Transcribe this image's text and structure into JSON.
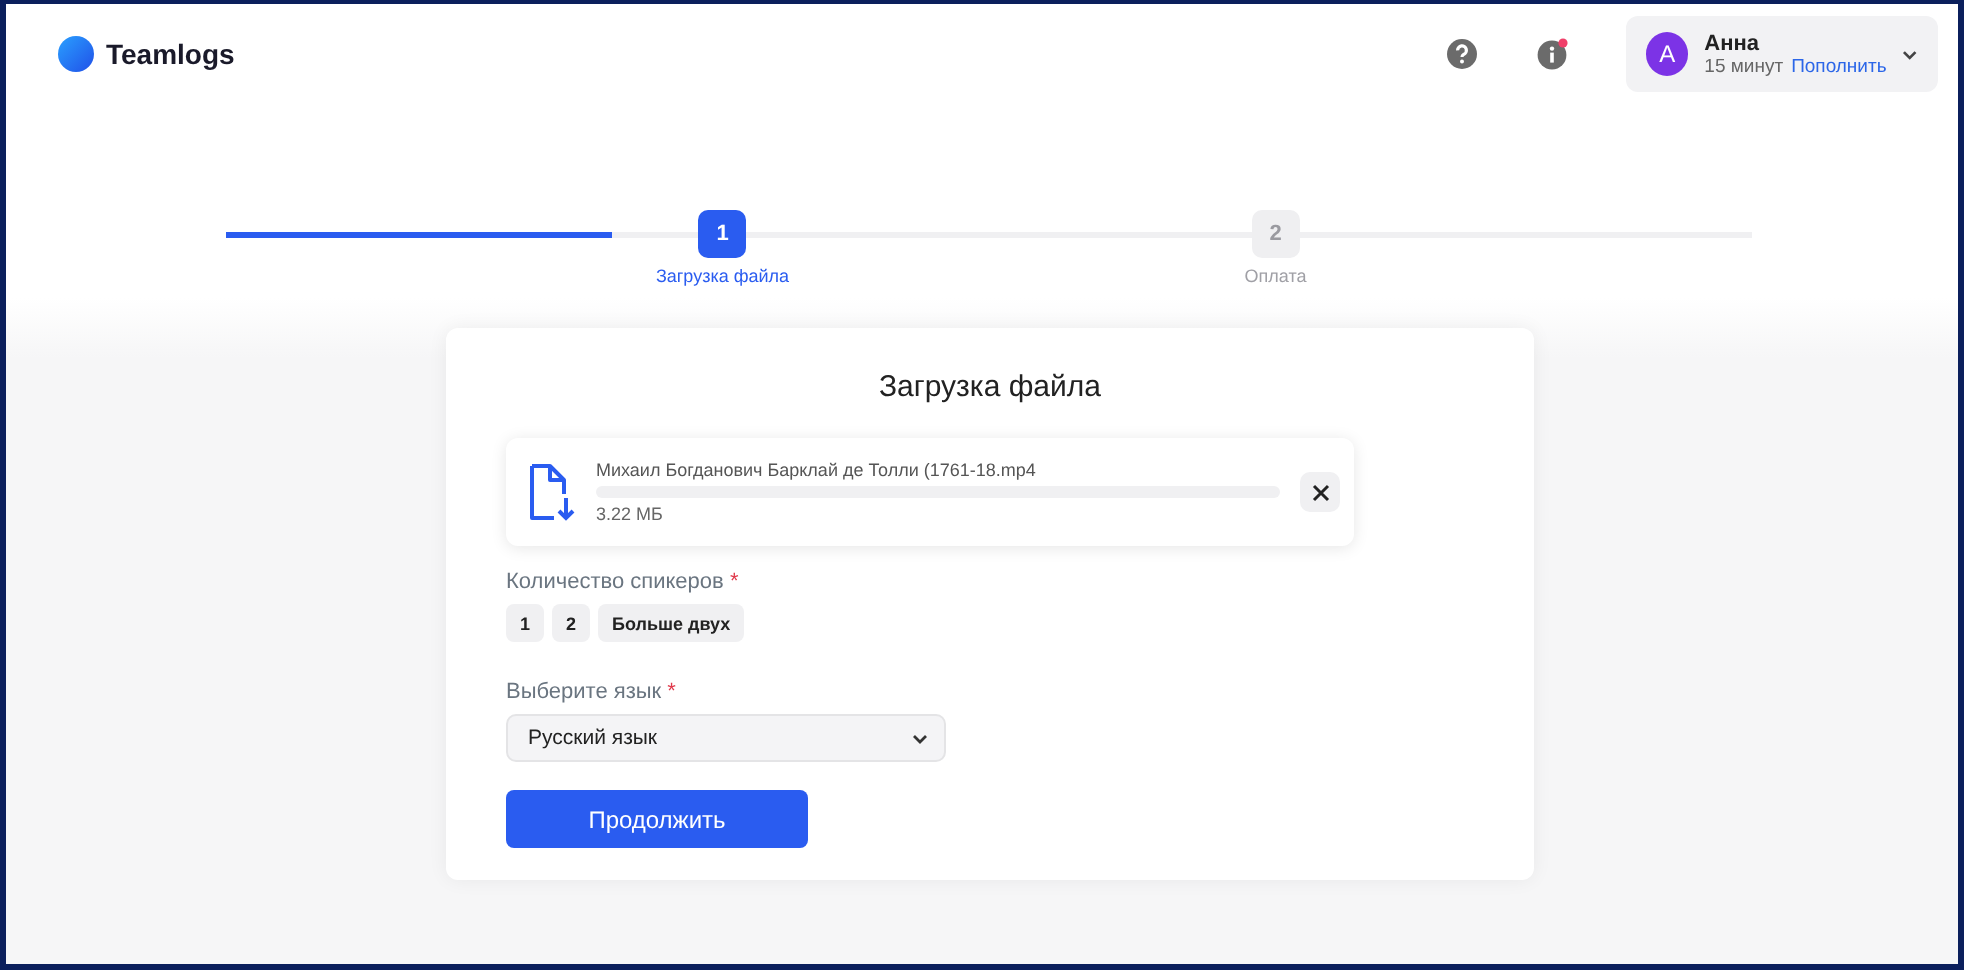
{
  "header": {
    "logo": "Teamlogs",
    "user": {
      "initial": "А",
      "name": "Анна",
      "balance": "15 минут",
      "topup_link": "Пополнить"
    },
    "info_notification": true
  },
  "steps": [
    {
      "number": "1",
      "label": "Загрузка файла",
      "selected": true
    },
    {
      "number": "2",
      "label": "Оплата",
      "selected": false
    }
  ],
  "form": {
    "title": "Загрузка файла",
    "file": {
      "name": "Михаил Богданович Барклай де Толли (1761-18.mp4",
      "size": "3.22 МБ",
      "level": 0
    },
    "speakers": {
      "label": "Количество спикеров",
      "required_mark": "*",
      "options": [
        {
          "label": "1",
          "selected": false
        },
        {
          "label": "2",
          "selected": false
        },
        {
          "label": "Больше двух",
          "selected": false
        }
      ]
    },
    "language": {
      "label": "Выберите язык",
      "required_mark": "*",
      "value": "Русский язык"
    },
    "submit": "Продолжить"
  }
}
